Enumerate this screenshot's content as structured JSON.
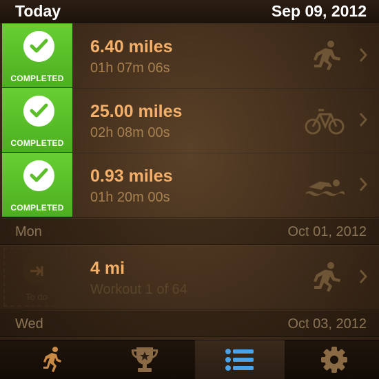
{
  "header": {
    "day": "Today",
    "date": "Sep 09, 2012"
  },
  "workouts": [
    {
      "status": "COMPLETED",
      "distance": "6.40 miles",
      "duration": "01h 07m 06s",
      "activity_icon": "running-icon"
    },
    {
      "status": "COMPLETED",
      "distance": "25.00 miles",
      "duration": "02h 08m 00s",
      "activity_icon": "cycling-icon"
    },
    {
      "status": "COMPLETED",
      "distance": "0.93 miles",
      "duration": "01h 20m 00s",
      "activity_icon": "swimming-icon"
    }
  ],
  "sections": [
    {
      "day": "Mon",
      "date": "Oct 01, 2012"
    },
    {
      "day": "Wed",
      "date": "Oct 03, 2012"
    }
  ],
  "upcoming": [
    {
      "status": "To do",
      "distance": "4 mi",
      "subtitle": "Workout 1 of 64",
      "activity_icon": "running-icon"
    }
  ],
  "tabs": [
    {
      "name": "runner-icon",
      "active": false
    },
    {
      "name": "trophy-icon",
      "active": false
    },
    {
      "name": "list-icon",
      "active": true
    },
    {
      "name": "gear-icon",
      "active": false
    }
  ],
  "colors": {
    "completed_green": "#5cbf2a",
    "distance_orange": "#f4b06a",
    "duration_tan": "#a8814f",
    "active_tab_blue": "#4aa3e8"
  }
}
